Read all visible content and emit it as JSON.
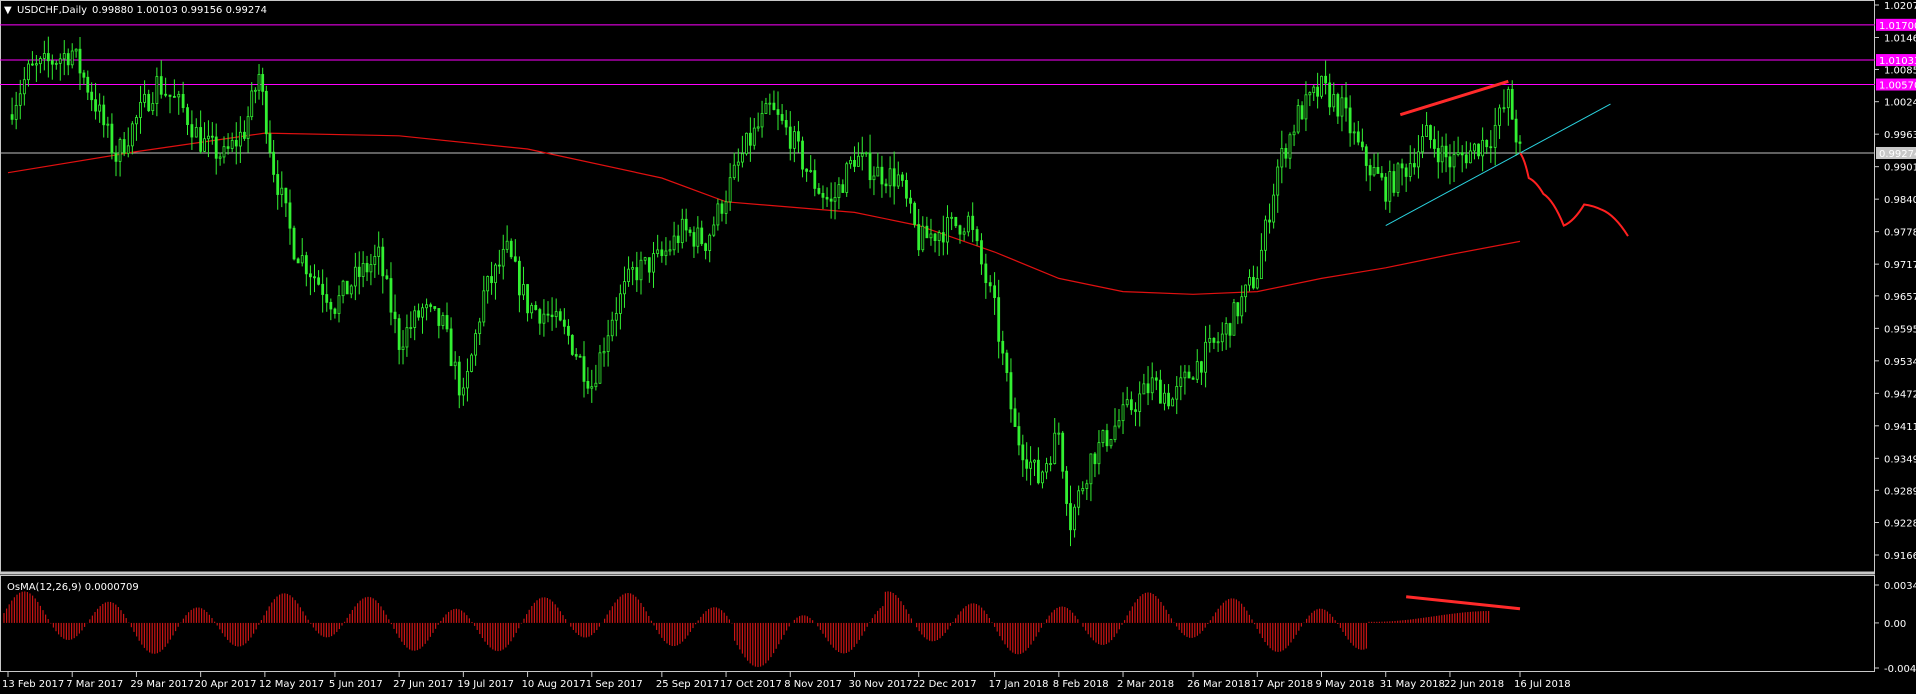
{
  "chart_data": {
    "type": "candlestick",
    "symbol_label": "USDCHF,Daily",
    "ohlc_label": "0.99880 1.00103 0.99156 0.99274",
    "current_price_label": "0.99274",
    "current_price": 0.99274,
    "ylim": [
      0.91665,
      1.02075
    ],
    "price_ticks": [
      "1.02075",
      "1.01460",
      "1.00855",
      "1.00245",
      "0.99630",
      "0.99015",
      "0.98400",
      "0.97785",
      "0.97170",
      "0.96570",
      "0.95955",
      "0.95340",
      "0.94725",
      "0.94110",
      "0.93495",
      "0.92890",
      "0.92280",
      "0.91665"
    ],
    "horizontal_levels": [
      {
        "label": "1.01700",
        "value": 1.017,
        "color": "#ff00ff"
      },
      {
        "label": "1.01033",
        "value": 1.01033,
        "color": "#ff00ff"
      },
      {
        "label": "1.00570",
        "value": 1.0057,
        "color": "#ff00ff"
      }
    ],
    "date_ticks": [
      "13 Feb 2017",
      "7 Mar 2017",
      "29 Mar 2017",
      "20 Apr 2017",
      "12 May 2017",
      "5 Jun 2017",
      "27 Jun 2017",
      "19 Jul 2017",
      "10 Aug 2017",
      "1 Sep 2017",
      "25 Sep 2017",
      "17 Oct 2017",
      "8 Nov 2017",
      "30 Nov 2017",
      "22 Dec 2017",
      "17 Jan 2018",
      "8 Feb 2018",
      "2 Mar 2018",
      "26 Mar 2018",
      "17 Apr 2018",
      "9 May 2018",
      "31 May 2018",
      "22 Jun 2018",
      "16 Jul 2018"
    ],
    "close_path": [
      [
        "13 Feb 2017",
        1.0
      ],
      [
        "20 Feb 2017",
        1.008
      ],
      [
        "7 Mar 2017",
        1.012
      ],
      [
        "15 Mar 2017",
        1.002
      ],
      [
        "22 Mar 2017",
        0.992
      ],
      [
        "29 Mar 2017",
        0.999
      ],
      [
        "5 Apr 2017",
        1.006
      ],
      [
        "14 Apr 2017",
        1.001
      ],
      [
        "20 Apr 2017",
        0.995
      ],
      [
        "28 Apr 2017",
        0.992
      ],
      [
        "5 May 2017",
        0.997
      ],
      [
        "10 May 2017",
        1.0075
      ],
      [
        "15 May 2017",
        0.99
      ],
      [
        "22 May 2017",
        0.975
      ],
      [
        "5 Jun 2017",
        0.964
      ],
      [
        "12 Jun 2017",
        0.969
      ],
      [
        "20 Jun 2017",
        0.973
      ],
      [
        "27 Jun 2017",
        0.957
      ],
      [
        "5 Jul 2017",
        0.963
      ],
      [
        "12 Jul 2017",
        0.96
      ],
      [
        "19 Jul 2017",
        0.946
      ],
      [
        "26 Jul 2017",
        0.966
      ],
      [
        "3 Aug 2017",
        0.974
      ],
      [
        "10 Aug 2017",
        0.964
      ],
      [
        "17 Aug 2017",
        0.962
      ],
      [
        "24 Aug 2017",
        0.958
      ],
      [
        "1 Sep 2017",
        0.949
      ],
      [
        "8 Sep 2017",
        0.962
      ],
      [
        "15 Sep 2017",
        0.97
      ],
      [
        "25 Sep 2017",
        0.973
      ],
      [
        "2 Oct 2017",
        0.978
      ],
      [
        "10 Oct 2017",
        0.976
      ],
      [
        "17 Oct 2017",
        0.985
      ],
      [
        "24 Oct 2017",
        0.994
      ],
      [
        "1 Nov 2017",
        1.001
      ],
      [
        "8 Nov 2017",
        0.996
      ],
      [
        "15 Nov 2017",
        0.988
      ],
      [
        "22 Nov 2017",
        0.983
      ],
      [
        "30 Nov 2017",
        0.992
      ],
      [
        "8 Dec 2017",
        0.989
      ],
      [
        "15 Dec 2017",
        0.988
      ],
      [
        "22 Dec 2017",
        0.976
      ],
      [
        "29 Dec 2017",
        0.978
      ],
      [
        "8 Jan 2018",
        0.98
      ],
      [
        "17 Jan 2018",
        0.963
      ],
      [
        "24 Jan 2018",
        0.94
      ],
      [
        "1 Feb 2018",
        0.931
      ],
      [
        "8 Feb 2018",
        0.94
      ],
      [
        "12 Feb 2018",
        0.923
      ],
      [
        "19 Feb 2018",
        0.935
      ],
      [
        "2 Mar 2018",
        0.943
      ],
      [
        "12 Mar 2018",
        0.949
      ],
      [
        "19 Mar 2018",
        0.946
      ],
      [
        "26 Mar 2018",
        0.952
      ],
      [
        "5 Apr 2018",
        0.958
      ],
      [
        "17 Apr 2018",
        0.97
      ],
      [
        "24 Apr 2018",
        0.99
      ],
      [
        "1 May 2018",
        1.0
      ],
      [
        "9 May 2018",
        1.005
      ],
      [
        "16 May 2018",
        1.001
      ],
      [
        "23 May 2018",
        0.992
      ],
      [
        "31 May 2018",
        0.986
      ],
      [
        "7 Jun 2018",
        0.99
      ],
      [
        "14 Jun 2018",
        0.996
      ],
      [
        "22 Jun 2018",
        0.991
      ],
      [
        "29 Jun 2018",
        0.993
      ],
      [
        "6 Jul 2018",
        0.996
      ],
      [
        "12 Jul 2018",
        1.003
      ],
      [
        "16 Jul 2018",
        0.99274
      ]
    ],
    "moving_average": [
      [
        "13 Feb 2017",
        0.989
      ],
      [
        "29 Mar 2017",
        0.993
      ],
      [
        "12 May 2017",
        0.9965
      ],
      [
        "27 Jun 2017",
        0.996
      ],
      [
        "10 Aug 2017",
        0.9935
      ],
      [
        "25 Sep 2017",
        0.988
      ],
      [
        "17 Oct 2017",
        0.9835
      ],
      [
        "30 Nov 2017",
        0.9815
      ],
      [
        "22 Dec 2017",
        0.979
      ],
      [
        "17 Jan 2018",
        0.974
      ],
      [
        "8 Feb 2018",
        0.969
      ],
      [
        "2 Mar 2018",
        0.9665
      ],
      [
        "26 Mar 2018",
        0.966
      ],
      [
        "17 Apr 2018",
        0.9665
      ],
      [
        "9 May 2018",
        0.969
      ],
      [
        "31 May 2018",
        0.971
      ],
      [
        "22 Jun 2018",
        0.9735
      ],
      [
        "16 Jul 2018",
        0.976
      ]
    ],
    "forecast_path": [
      [
        "16 Jul 2018",
        0.99274
      ],
      [
        "19 Jul 2018",
        0.988
      ],
      [
        "24 Jul 2018",
        0.985
      ],
      [
        "31 Jul 2018",
        0.979
      ],
      [
        "7 Aug 2018",
        0.983
      ],
      [
        "13 Aug 2018",
        0.982
      ],
      [
        "22 Aug 2018",
        0.977
      ]
    ],
    "indicator": {
      "label": "OsMA(12,26,9) 0.0000709",
      "ticks": [
        "0.003482",
        "0.00",
        "-0.004140"
      ],
      "ylim": [
        -0.00414,
        0.003482
      ]
    }
  }
}
